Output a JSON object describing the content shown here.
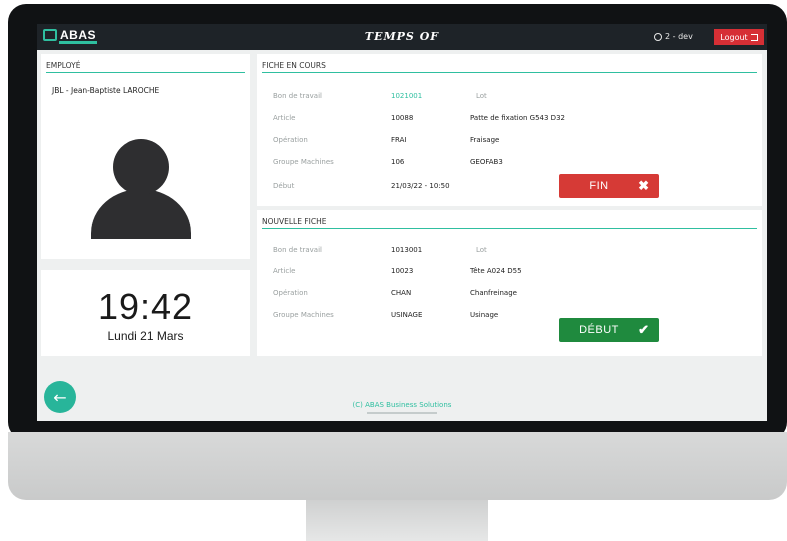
{
  "app": {
    "logo": "ABAS",
    "title": "TEMPS OF",
    "user": "2 - dev",
    "logout_label": "Logout"
  },
  "employee": {
    "header": "EMPLOYÉ",
    "name": "JBL - Jean-Baptiste LAROCHE"
  },
  "clock": {
    "time": "19:42",
    "date": "Lundi 21 Mars"
  },
  "current_sheet": {
    "header": "FICHE EN COURS",
    "rows": [
      {
        "label": "Bon de travail",
        "value": "1021001",
        "extra": "Lot"
      },
      {
        "label": "Article",
        "value": "10088",
        "extra": "Patte de fixation G543 D32"
      },
      {
        "label": "Opération",
        "value": "FRAI",
        "extra": "Fraisage"
      },
      {
        "label": "Groupe Machines",
        "value": "106",
        "extra": "GEOFAB3"
      },
      {
        "label": "Début",
        "value": "21/03/22 - 10:50",
        "extra": ""
      }
    ],
    "button_label": "FIN"
  },
  "new_sheet": {
    "header": "NOUVELLE FICHE",
    "rows": [
      {
        "label": "Bon de travail",
        "value": "1013001",
        "extra": "Lot"
      },
      {
        "label": "Article",
        "value": "10023",
        "extra": "Tête A024 D55"
      },
      {
        "label": "Opération",
        "value": "CHAN",
        "extra": "Chanfreinage"
      },
      {
        "label": "Groupe Machines",
        "value": "USINAGE",
        "extra": "Usinage"
      }
    ],
    "button_label": "DÉBUT"
  },
  "footer": {
    "copyright": "(C) ABAS Business Solutions"
  },
  "colors": {
    "accent": "#2fbfa0",
    "danger": "#d63a36",
    "success": "#1f8a3e",
    "topbar": "#1e2328"
  },
  "icons": {
    "back": "arrow-left-icon",
    "close": "close-icon",
    "check": "check-icon",
    "user": "user-icon",
    "logout": "logout-icon"
  }
}
